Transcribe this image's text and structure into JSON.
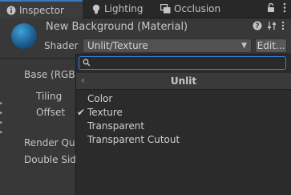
{
  "tabs": [
    {
      "label": "Inspector",
      "icon": "info-icon",
      "active": true
    },
    {
      "label": "Lighting",
      "icon": "lightbulb-icon",
      "active": false
    },
    {
      "label": "Occlusion",
      "icon": "occlusion-icon",
      "active": false
    }
  ],
  "header": {
    "material_title": "New Background (Material)",
    "shader_label": "Shader",
    "shader_value": "Unlit/Texture",
    "edit_label": "Edit..."
  },
  "properties": {
    "base": "Base (RGB)",
    "tiling": "Tiling",
    "offset": "Offset",
    "render_queue": "Render Que",
    "double_sided": "Double Side"
  },
  "popup": {
    "search_value": "",
    "breadcrumb": "Unlit",
    "items": [
      {
        "label": "Color",
        "checked": false
      },
      {
        "label": "Texture",
        "checked": true
      },
      {
        "label": "Transparent",
        "checked": false
      },
      {
        "label": "Transparent Cutout",
        "checked": false
      }
    ],
    "check_glyph": "✔"
  },
  "colors": {
    "accent": "#3a79bb",
    "panel": "#383838",
    "popup": "#2b2b2b"
  }
}
